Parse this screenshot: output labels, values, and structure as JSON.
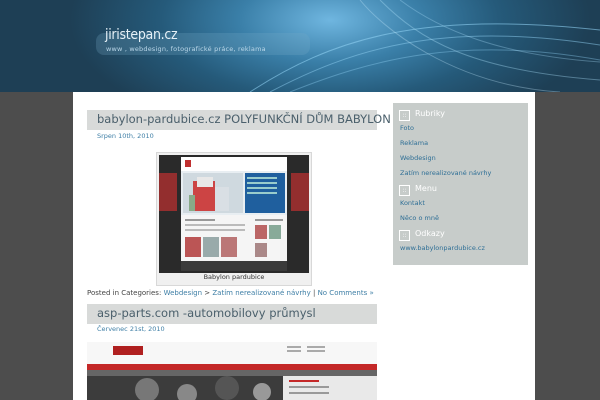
{
  "header": {
    "site_title": "jiristepan.cz",
    "site_description": "www , webdesign, fotografické práce, reklama"
  },
  "posts": [
    {
      "title": "babylon-pardubice.cz POLYFUNKČNÍ DŮM BABYLON",
      "date": "Srpen 10th, 2010",
      "image_caption": "Babylon pardubice",
      "meta_prefix": "Posted in Categories:",
      "categories": [
        "Webdesign",
        "Zatím nerealizované návrhy"
      ],
      "separator": ">",
      "comments": "No Comments »"
    },
    {
      "title": "asp-parts.com -automobilovy průmysl",
      "date": "Červenec 21st, 2010"
    }
  ],
  "sidebar": {
    "sections": [
      {
        "heading": "Rubriky",
        "links": [
          "Foto",
          "Reklama",
          "Webdesign",
          "Zatím nerealizované návrhy"
        ]
      },
      {
        "heading": "Menu",
        "links": [
          "Kontakt",
          "Něco o mně"
        ]
      },
      {
        "heading": "Odkazy",
        "links": [
          "www.babylonpardubice.cz"
        ]
      }
    ]
  },
  "colors": {
    "header_blue": "#2f6b90",
    "link": "#3f7fa6",
    "sidebar_bg": "#c7ccca",
    "title_bar": "#d8dad9",
    "page_bg": "#4d4d4d"
  }
}
